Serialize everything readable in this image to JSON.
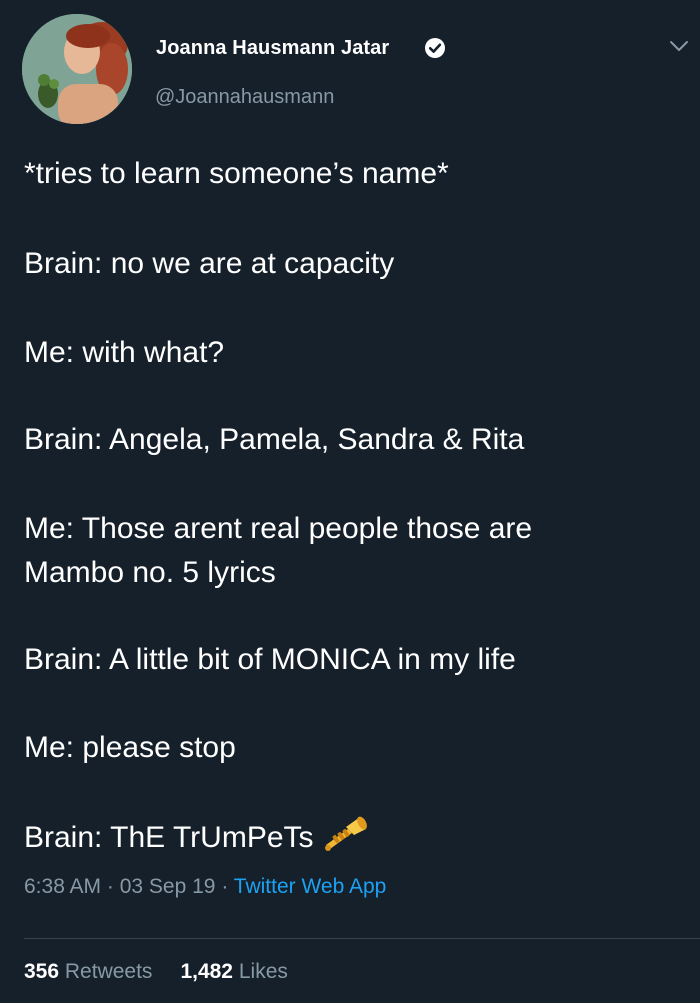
{
  "author": {
    "name": "Joanna Hausmann Jatar",
    "handle": "@Joannahausmann",
    "verified": true
  },
  "tweet_lines": [
    "*tries to learn someone’s name*",
    "Brain: no we are at capacity",
    "Me: with what?",
    "Brain: Angela, Pamela, Sandra & Rita",
    "Me: Those arent real people those are",
    "Mambo no. 5 lyrics",
    "Brain: A little bit of MONICA in my life",
    "Me: please stop",
    "Brain: ThE TrUmPeTs"
  ],
  "emoji": {
    "icon": "trumpet-icon"
  },
  "meta": {
    "time": "6:38 AM",
    "sep1": " · ",
    "date": "03 Sep 19",
    "sep2": " · ",
    "app": "Twitter Web App"
  },
  "stats": {
    "retweets_count": "356",
    "retweets_label": "Retweets",
    "likes_count": "1,482",
    "likes_label": "Likes"
  },
  "colors": {
    "background": "#15202b",
    "text": "#ffffff",
    "secondary": "#8899a6",
    "link": "#1da1f2",
    "divider": "#38444d"
  }
}
